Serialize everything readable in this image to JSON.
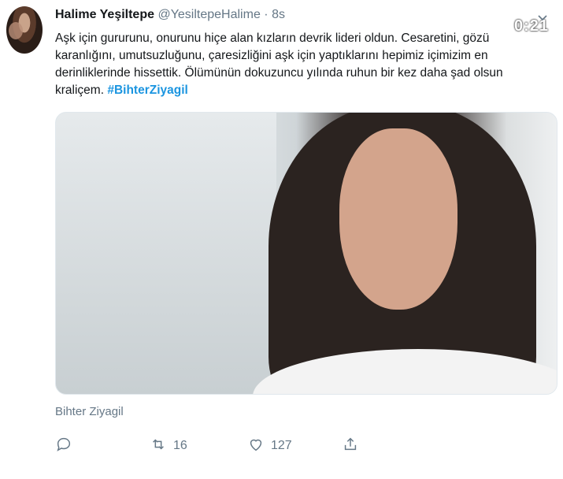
{
  "tweet": {
    "author_name": "Halime Yeşiltepe",
    "author_handle": "@YesiltepeHalime",
    "separator": "·",
    "time": "8s",
    "text_main": "Aşk için gururunu, onurunu hiçe alan kızların devrik lideri oldun. Cesaretini, gözü karanlığını, umutsuzluğunu, çaresizliğini aşk için yaptıklarını hepimiz içimizim en derinliklerinde hissettik. Ölümünün dokuzuncu yılında ruhun bir kez daha şad olsun kraliçem. ",
    "hashtag": "#BihterZiyagil",
    "media_caption": "Bihter Ziyagil"
  },
  "overlay": {
    "timer": "0:21"
  },
  "actions": {
    "reply_count": "",
    "retweet_count": "16",
    "like_count": "127"
  },
  "icons": {
    "reply": "reply-icon",
    "retweet": "retweet-icon",
    "like": "heart-icon",
    "share": "share-icon",
    "more": "chevron-down-icon"
  },
  "colors": {
    "hashtag": "#1b95e0",
    "muted": "#657786",
    "text": "#14171a"
  }
}
